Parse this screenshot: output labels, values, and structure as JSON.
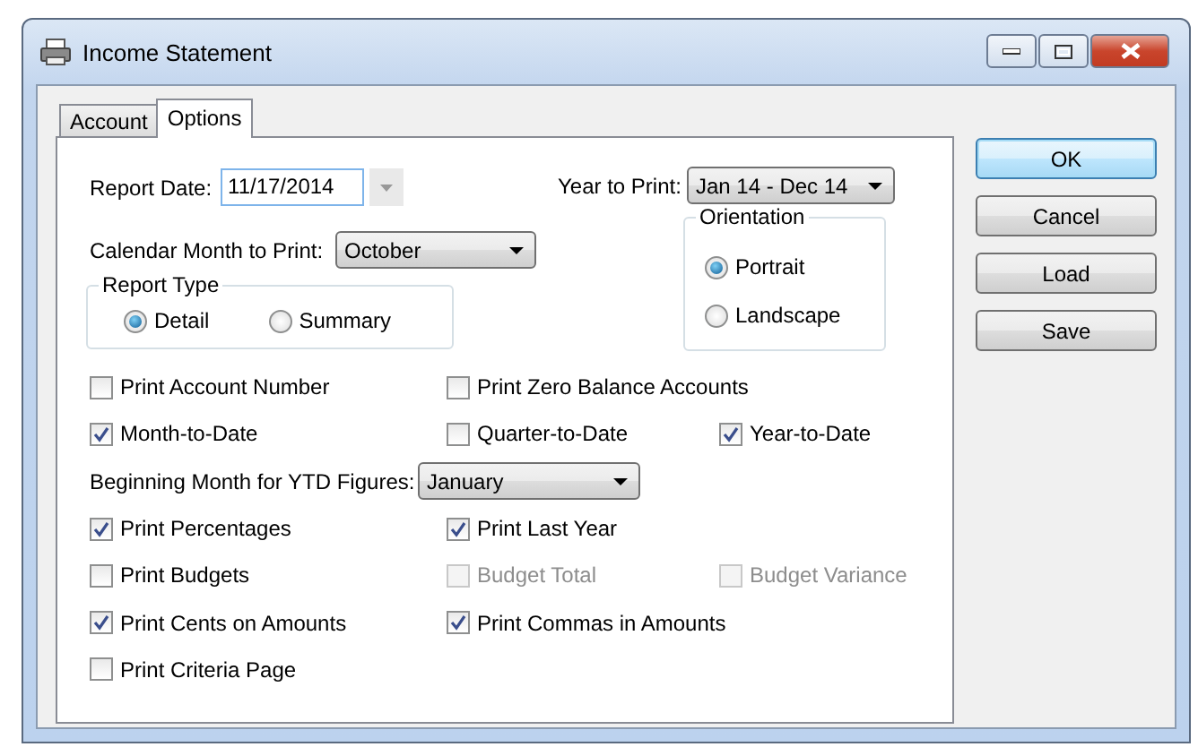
{
  "window": {
    "title": "Income Statement"
  },
  "tabs": [
    {
      "label": "Account",
      "selected": false
    },
    {
      "label": "Options",
      "selected": true
    }
  ],
  "report_date": {
    "label": "Report Date:",
    "value": "11/17/2014"
  },
  "year_to_print": {
    "label": "Year to Print:",
    "value": "Jan 14 - Dec 14"
  },
  "calendar_month": {
    "label": "Calendar Month to Print:",
    "value": "October"
  },
  "report_type": {
    "title": "Report Type",
    "options": [
      {
        "label": "Detail",
        "selected": true
      },
      {
        "label": "Summary",
        "selected": false
      }
    ]
  },
  "orientation": {
    "title": "Orientation",
    "options": [
      {
        "label": "Portrait",
        "selected": true
      },
      {
        "label": "Landscape",
        "selected": false
      }
    ]
  },
  "option_rows": [
    {
      "kind": "checks",
      "items": [
        {
          "label": "Print Account Number",
          "checked": false,
          "disabled": false
        },
        {
          "label": "Print Zero Balance Accounts",
          "checked": false,
          "disabled": false
        }
      ]
    },
    {
      "kind": "checks",
      "items": [
        {
          "label": "Month-to-Date",
          "checked": true,
          "disabled": false
        },
        {
          "label": "Quarter-to-Date",
          "checked": false,
          "disabled": false
        },
        {
          "label": "Year-to-Date",
          "checked": true,
          "disabled": false
        }
      ]
    },
    {
      "kind": "dropdown",
      "label": "Beginning Month for YTD Figures:",
      "value": "January"
    },
    {
      "kind": "checks",
      "items": [
        {
          "label": "Print Percentages",
          "checked": true,
          "disabled": false
        },
        {
          "label": "Print Last Year",
          "checked": true,
          "disabled": false
        }
      ]
    },
    {
      "kind": "checks",
      "items": [
        {
          "label": "Print Budgets",
          "checked": false,
          "disabled": false
        },
        {
          "label": "Budget Total",
          "checked": false,
          "disabled": true
        },
        {
          "label": "Budget Variance",
          "checked": false,
          "disabled": true
        }
      ]
    },
    {
      "kind": "checks",
      "items": [
        {
          "label": "Print Cents on Amounts",
          "checked": true,
          "disabled": false
        },
        {
          "label": "Print Commas in Amounts",
          "checked": true,
          "disabled": false
        }
      ]
    },
    {
      "kind": "checks",
      "items": [
        {
          "label": "Print Criteria Page",
          "checked": false,
          "disabled": false
        }
      ]
    }
  ],
  "buttons": [
    {
      "label": "OK",
      "default": true
    },
    {
      "label": "Cancel",
      "default": false
    },
    {
      "label": "Load",
      "default": false
    },
    {
      "label": "Save",
      "default": false
    }
  ]
}
